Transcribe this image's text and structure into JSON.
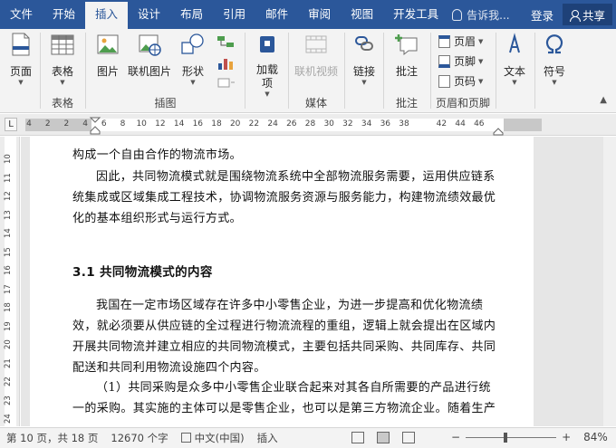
{
  "tabs": {
    "file": "文件",
    "home": "开始",
    "insert": "插入",
    "design": "设计",
    "layout": "布局",
    "references": "引用",
    "mailings": "邮件",
    "review": "审阅",
    "view": "视图",
    "developer": "开发工具"
  },
  "tell_me": "告诉我...",
  "login": "登录",
  "share": "共享",
  "ribbon": {
    "pages": {
      "label": "页面",
      "group": ""
    },
    "table": {
      "label": "表格",
      "group": "表格"
    },
    "illus": {
      "picture": "图片",
      "online_picture": "联机图片",
      "shapes": "形状",
      "group": "插图"
    },
    "addins": {
      "label": "加载项"
    },
    "media": {
      "online_video": "联机视频",
      "group": "媒体"
    },
    "link": {
      "label": "链接"
    },
    "comment": {
      "label": "批注",
      "group": "批注"
    },
    "header_footer": {
      "header": "页眉",
      "footer": "页脚",
      "page_number": "页码",
      "group": "页眉和页脚"
    },
    "text": {
      "label": "文本"
    },
    "symbol": {
      "label": "符号"
    }
  },
  "ruler": {
    "marker": "L",
    "ticks": [
      "4",
      "2",
      "2",
      "4",
      "6",
      "8",
      "10",
      "12",
      "14",
      "16",
      "18",
      "20",
      "22",
      "24",
      "26",
      "28",
      "30",
      "32",
      "34",
      "36",
      "38",
      "42",
      "44",
      "46"
    ],
    "vticks": [
      "10",
      "11",
      "12",
      "13",
      "14",
      "15",
      "16",
      "17",
      "18",
      "19",
      "20",
      "21",
      "22",
      "23",
      "24"
    ]
  },
  "doc": {
    "line_prev": "构成一个自由合作的物流市场。",
    "p1_l1": "因此，共同物流模式就是围绕物流系统中全部物流服务需要，运用供应链系",
    "p1_l2": "统集成或区域集成工程技术，协调物流服务资源与服务能力，构建物流绩效最优",
    "p1_l3": "化的基本组织形式与运行方式。",
    "heading": "3.1 共同物流模式的内容",
    "p2_l1": "我国在一定市场区域存在许多中小零售企业，为进一步提高和优化物流绩",
    "p2_l2": "效，就必须要从供应链的全过程进行物流流程的重组，逻辑上就会提出在区域内",
    "p2_l3": "开展共同物流并建立相应的共同物流模式，主要包括共同采购、共同库存、共同",
    "p2_l4": "配送和共同利用物流设施四个内容。",
    "p3_l1": "（1）共同采购是众多中小零售企业联合起来对其各自所需要的产品进行统",
    "p3_l2": "一的采购。其实施的主体可以是零售企业，也可以是第三方物流企业。随着生产"
  },
  "status": {
    "page": "第 10 页，共 18 页",
    "words": "12670 个字",
    "language": "中文(中国)",
    "mode": "插入",
    "zoom": "84%",
    "zoom_value": 0.84
  },
  "colors": {
    "accent": "#2b579a",
    "ribbon_bg": "#f3f3f3",
    "doc_bg": "#e6e6e6"
  }
}
